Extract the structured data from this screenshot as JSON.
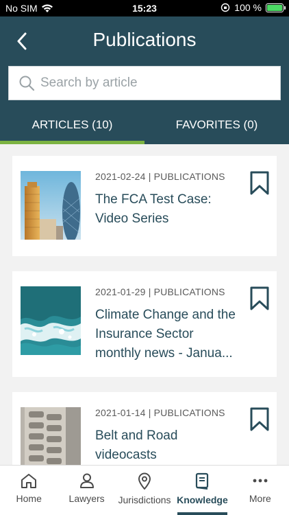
{
  "status_bar": {
    "carrier": "No SIM",
    "time": "15:23",
    "battery": "100 %"
  },
  "header": {
    "title": "Publications"
  },
  "search": {
    "placeholder": "Search by article"
  },
  "tabs": [
    {
      "label": "ARTICLES (10)",
      "active": true
    },
    {
      "label": "FAVORITES (0)",
      "active": false
    }
  ],
  "articles": [
    {
      "meta": "2021-02-24 | PUBLICATIONS",
      "title": "The FCA Test Case: Video Series",
      "image": "city-skyline-image"
    },
    {
      "meta": "2021-01-29 | PUBLICATIONS",
      "title": "Climate Change and the Insurance Sector monthly news - Janua...",
      "image": "ocean-waves-image"
    },
    {
      "meta": "2021-01-14 | PUBLICATIONS",
      "title": "Belt and Road videocasts",
      "image": "tire-tread-image"
    }
  ],
  "bottom_nav": [
    {
      "label": "Home",
      "icon": "home-icon"
    },
    {
      "label": "Lawyers",
      "icon": "person-icon"
    },
    {
      "label": "Jurisdictions",
      "icon": "location-pin-icon"
    },
    {
      "label": "Knowledge",
      "icon": "book-icon",
      "active": true
    },
    {
      "label": "More",
      "icon": "more-dots-icon"
    }
  ],
  "colors": {
    "header_bg": "#284c5a",
    "tab_indicator": "#7cb342",
    "title_text": "#284c5a"
  }
}
